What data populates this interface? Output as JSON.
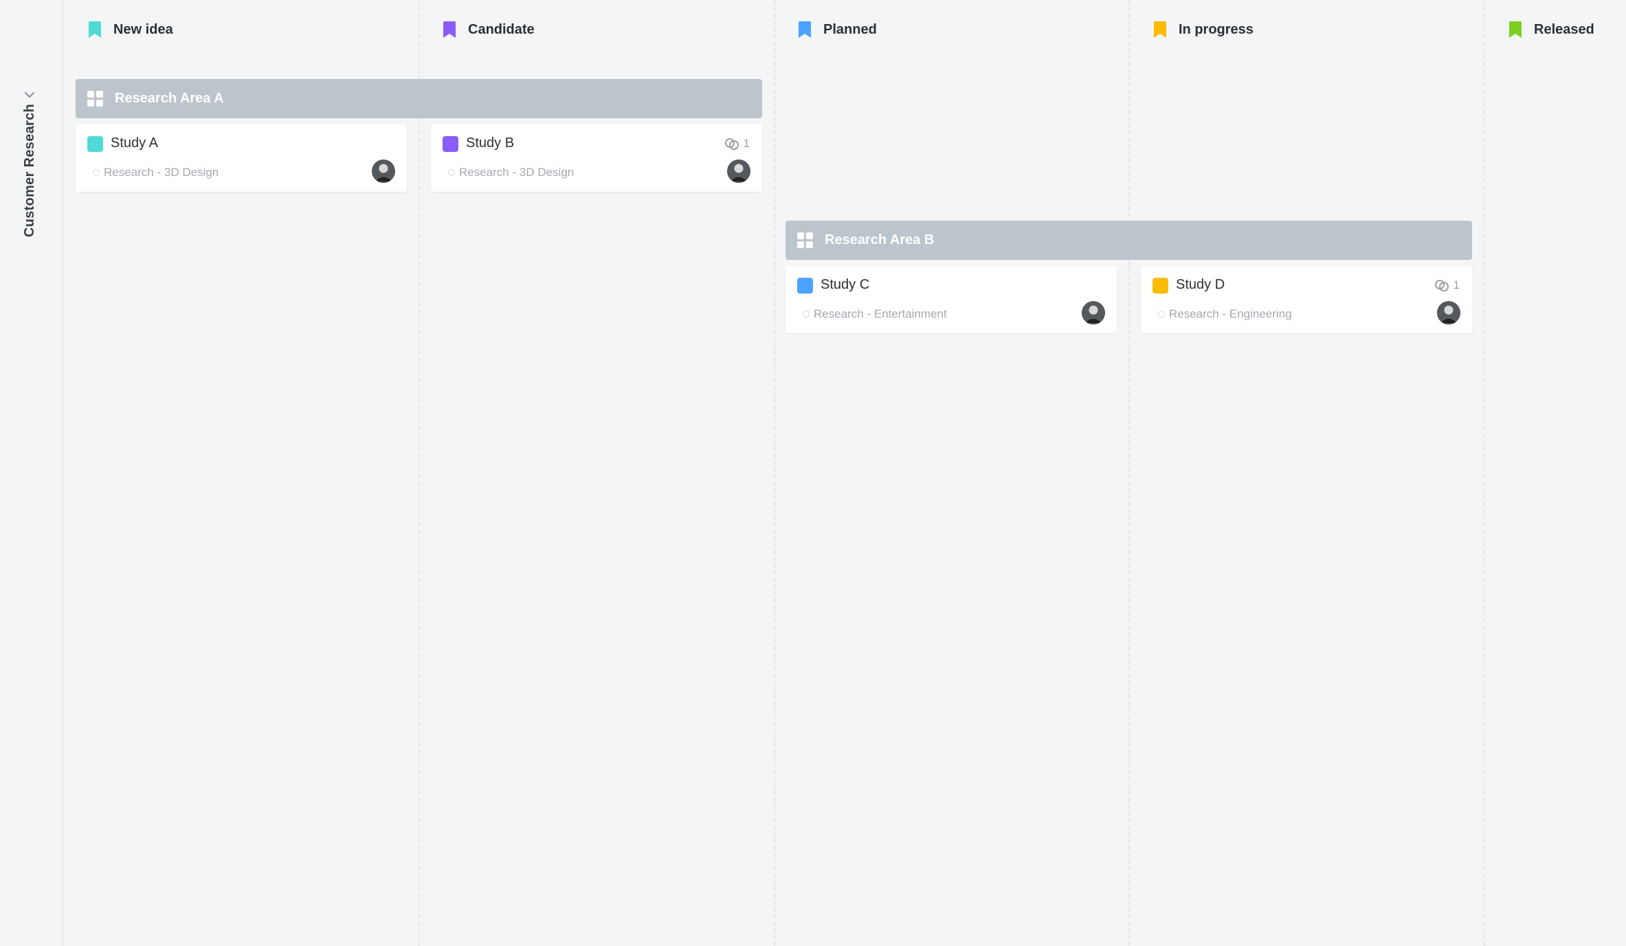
{
  "lane": {
    "label": "Customer Research",
    "chevron_icon": "chevron-down-icon"
  },
  "columns": [
    {
      "label": "New idea",
      "color": "#4fdbd4",
      "icon": "bookmark-icon"
    },
    {
      "label": "Candidate",
      "color": "#8b5cf6",
      "icon": "bookmark-icon"
    },
    {
      "label": "Planned",
      "color": "#4aa3ff",
      "icon": "bookmark-icon"
    },
    {
      "label": "In progress",
      "color": "#fcbc05",
      "icon": "bookmark-icon"
    },
    {
      "label": "Released",
      "color": "#7ccf1f",
      "icon": "bookmark-icon"
    }
  ],
  "groups": [
    {
      "title": "Research Area A",
      "icon": "grid-icon"
    },
    {
      "title": "Research Area B",
      "icon": "grid-icon"
    }
  ],
  "cards": [
    {
      "title": "Study A",
      "color": "#4fdbd4",
      "subtitle": "Research - 3D Design",
      "link_count": "",
      "avatar": "avatar"
    },
    {
      "title": "Study B",
      "color": "#8b5cf6",
      "subtitle": "Research - 3D Design",
      "link_count": "1",
      "avatar": "avatar"
    },
    {
      "title": "Study C",
      "color": "#4aa3ff",
      "subtitle": "Research - Entertainment",
      "link_count": "",
      "avatar": "avatar"
    },
    {
      "title": "Study D",
      "color": "#fcbc05",
      "subtitle": "Research - Engineering",
      "link_count": "1",
      "avatar": "avatar"
    }
  ],
  "colors": {
    "background": "#f3f5f7",
    "group_bar": "#bcc4cc",
    "card": "#ffffff"
  }
}
